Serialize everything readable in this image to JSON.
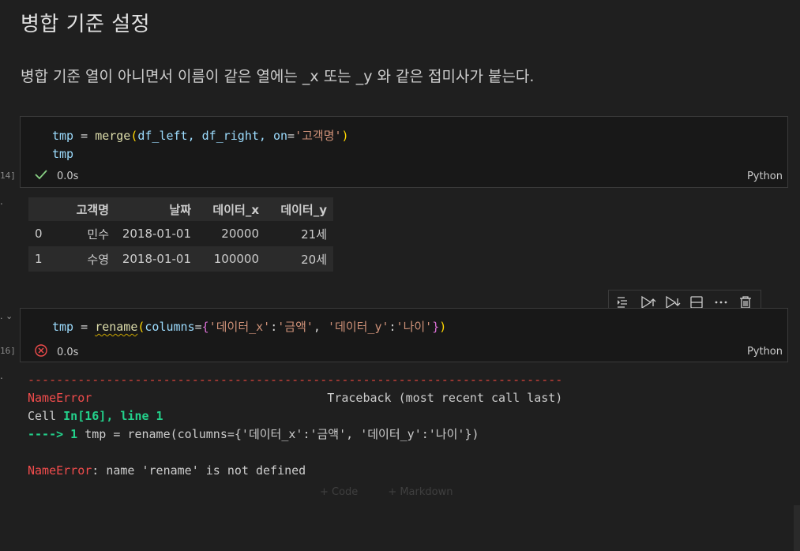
{
  "markdown": {
    "heading": "병합 기준 설정",
    "paragraph": "병합 기준 열이 아니면서 이름이 같은 열에는 _x 또는 _y 와 같은 접미사가 붙는다."
  },
  "cell1": {
    "exec_count": "14]",
    "line1": {
      "var": "tmp",
      "eq": " = ",
      "func": "merge",
      "open": "(",
      "args": "df_left, df_right, ",
      "kw": "on",
      "assign": "=",
      "str": "'고객명'",
      "close": ")"
    },
    "line2": "tmp",
    "duration": "0.0s",
    "language": "Python",
    "status": "success"
  },
  "output_table": {
    "columns": [
      "",
      "고객명",
      "날짜",
      "데이터_x",
      "데이터_y"
    ],
    "rows": [
      [
        "0",
        "민수",
        "2018-01-01",
        "20000",
        "21세"
      ],
      [
        "1",
        "수영",
        "2018-01-01",
        "100000",
        "20세"
      ]
    ]
  },
  "toolbar": {
    "icons": [
      "run-by-line-icon",
      "execute-above-icon",
      "execute-below-icon",
      "split-cell-icon",
      "more-icon",
      "delete-icon"
    ]
  },
  "cell2": {
    "exec_count": "16]",
    "line1": {
      "var": "tmp",
      "eq": " = ",
      "func": "rename",
      "open": "(",
      "kw": "columns",
      "assign": "=",
      "brace_open": "{",
      "k1": "'데이터_x'",
      "colon1": ":",
      "v1": "'금액'",
      "comma": ", ",
      "k2": "'데이터_y'",
      "colon2": ":",
      "v2": "'나이'",
      "brace_close": "}",
      "close": ")"
    },
    "duration": "0.0s",
    "language": "Python",
    "status": "error"
  },
  "traceback": {
    "dashes": "---------------------------------------------------------------------------",
    "error_name": "NameError",
    "spacer": "                                 ",
    "traceback_label": "Traceback (most recent call last)",
    "cell_prefix": "Cell ",
    "cell_ref": "In[16], line 1",
    "arrow": "----> 1 ",
    "code": "tmp = rename(columns={'데이터_x':'금액', '데이터_y':'나이'})",
    "error_name2": "NameError",
    "message": ": name 'rename' is not defined"
  },
  "add_cell": {
    "code_label": "+ Code",
    "markdown_label": "+ Markdown"
  },
  "colors": {
    "background": "#1f1f1f",
    "success": "#89d185",
    "error": "#f14c4c"
  }
}
